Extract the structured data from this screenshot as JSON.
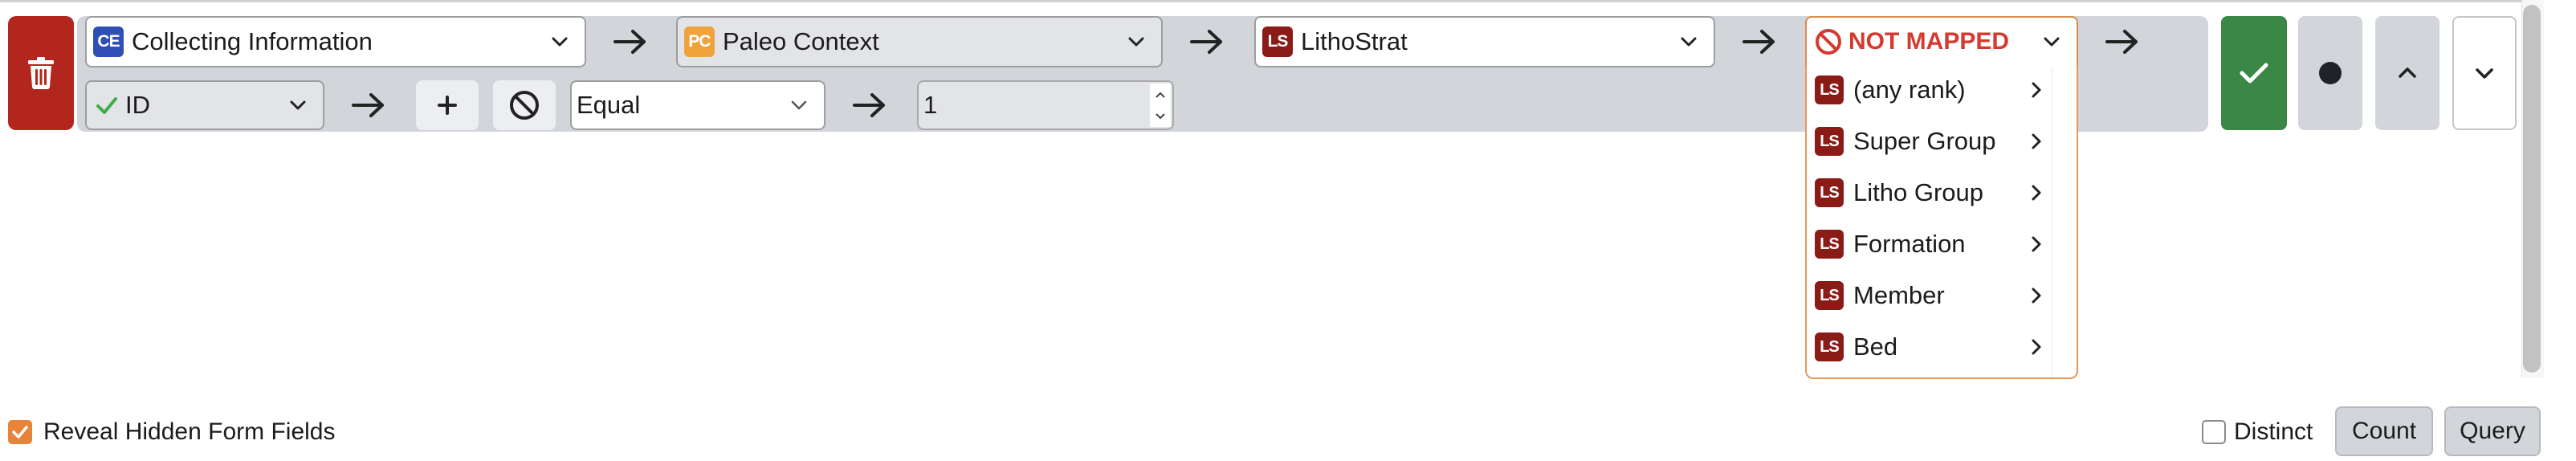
{
  "colors": {
    "line_bg": "#d2d5da",
    "delete": "#b3261e",
    "confirm": "#3b8745",
    "not_mapped": "#d5392f",
    "accent_orange": "#e8833a",
    "ce_icon": "#2e4fb5",
    "pc_icon": "#f0a23b",
    "ls_icon": "#8a1b16"
  },
  "mapping_line": {
    "delete_icon": "trash-icon",
    "path": [
      {
        "icon": "CE",
        "label": "Collecting Information"
      },
      {
        "icon": "PC",
        "label": "Paleo Context"
      },
      {
        "icon": "LS",
        "label": "LithoStrat"
      }
    ],
    "not_mapped": {
      "icon": "prohibited-icon",
      "label": "NOT MAPPED"
    },
    "dropdown_items": [
      {
        "icon": "LS",
        "label": "(any rank)"
      },
      {
        "icon": "LS",
        "label": "Super Group"
      },
      {
        "icon": "LS",
        "label": "Litho Group"
      },
      {
        "icon": "LS",
        "label": "Formation"
      },
      {
        "icon": "LS",
        "label": "Member"
      },
      {
        "icon": "LS",
        "label": "Bed"
      }
    ]
  },
  "filter_line": {
    "field": "ID",
    "add_icon": "plus-icon",
    "negate_icon": "prohibited-icon",
    "operator": "Equal",
    "value": "1"
  },
  "right_controls": {
    "confirm_icon": "check-icon",
    "dot_icon": "dot-icon",
    "up_icon": "chevron-up-icon",
    "down_icon": "chevron-down-icon"
  },
  "footer": {
    "reveal_label": "Reveal Hidden Form Fields",
    "reveal_checked": true,
    "distinct_label": "Distinct",
    "distinct_checked": false,
    "count_label": "Count",
    "query_label": "Query"
  }
}
